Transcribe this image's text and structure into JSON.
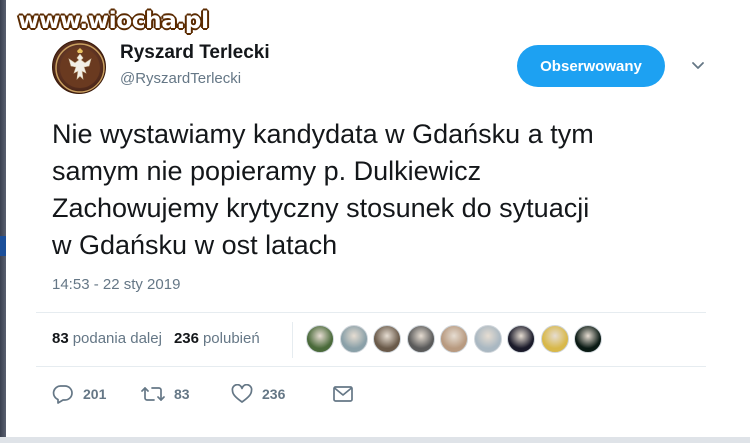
{
  "watermark": {
    "text": "www.wiocha.pl"
  },
  "author": {
    "display_name": "Ryszard Terlecki",
    "handle": "@RyszardTerlecki",
    "avatar": "eagle-emblem-avatar"
  },
  "header": {
    "follow_label": "Obserwowany",
    "menu_icon": "chevron-down-icon"
  },
  "tweet": {
    "lines": [
      "Nie wystawiamy kandydata w Gdańsku a tym",
      "samym nie popieramy p. Dulkiewicz",
      "Zachowujemy krytyczny stosunek do sytuacji",
      "w Gdańsku w ost latach"
    ],
    "timestamp": "14:53 - 22 sty 2019"
  },
  "stats": {
    "retweets_count": "83",
    "retweets_label": "podania dalej",
    "likes_count": "236",
    "likes_label": "polubień"
  },
  "likers": [
    {
      "name": "liker-avatar-1",
      "color": "#4a6a3a"
    },
    {
      "name": "liker-avatar-2",
      "color": "#8aa0a8"
    },
    {
      "name": "liker-avatar-3",
      "color": "#6a5a4a"
    },
    {
      "name": "liker-avatar-4",
      "color": "#5a5a5a"
    },
    {
      "name": "liker-avatar-5",
      "color": "#b89a80"
    },
    {
      "name": "liker-avatar-6",
      "color": "#aab8c2"
    },
    {
      "name": "liker-avatar-7",
      "color": "#1a1a2a"
    },
    {
      "name": "liker-avatar-8",
      "color": "#d8b84a"
    },
    {
      "name": "liker-avatar-9",
      "color": "#0a1a14"
    }
  ],
  "actions": {
    "reply_count": "201",
    "retweet_count": "83",
    "like_count": "236"
  },
  "colors": {
    "accent": "#1da1f2",
    "text_primary": "#14171a",
    "text_secondary": "#657786"
  }
}
